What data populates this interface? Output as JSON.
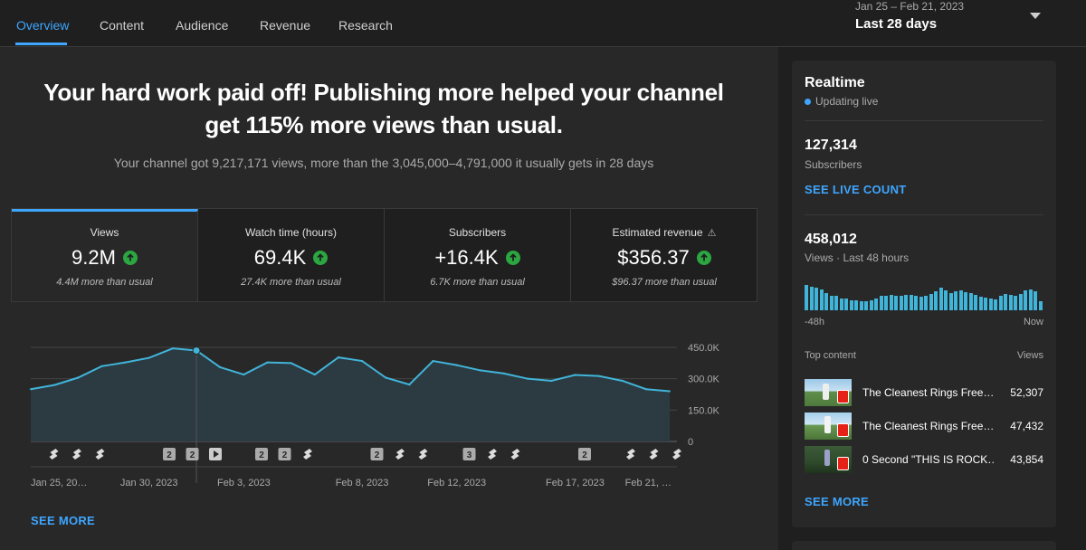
{
  "tabs": [
    {
      "label": "Overview",
      "active": true
    },
    {
      "label": "Content",
      "active": false
    },
    {
      "label": "Audience",
      "active": false
    },
    {
      "label": "Revenue",
      "active": false
    },
    {
      "label": "Research",
      "active": false
    }
  ],
  "date_range": {
    "range": "Jan 25 – Feb 21, 2023",
    "period": "Last 28 days"
  },
  "headline": {
    "line1": "Your hard work paid off! Publishing more helped your channel",
    "line2": "get 115% more views than usual.",
    "sub": "Your channel got 9,217,171 views, more than the 3,045,000–4,791,000 it usually gets in 28 days"
  },
  "metrics": [
    {
      "label": "Views",
      "value": "9.2M",
      "note": "4.4M more than usual",
      "trend": "up"
    },
    {
      "label": "Watch time (hours)",
      "value": "69.4K",
      "note": "27.4K more than usual",
      "trend": "up"
    },
    {
      "label": "Subscribers",
      "value": "+16.4K",
      "note": "6.7K more than usual",
      "trend": "up"
    },
    {
      "label": "Estimated revenue",
      "value": "$356.37",
      "note": "$96.37 more than usual",
      "trend": "up",
      "warning_icon": "warning-triangle-icon"
    }
  ],
  "chart_data": {
    "type": "area",
    "x": [
      "Jan 25",
      "Jan 26",
      "Jan 27",
      "Jan 28",
      "Jan 29",
      "Jan 30",
      "Jan 31",
      "Feb 1",
      "Feb 2",
      "Feb 3",
      "Feb 4",
      "Feb 5",
      "Feb 6",
      "Feb 7",
      "Feb 8",
      "Feb 9",
      "Feb 10",
      "Feb 11",
      "Feb 12",
      "Feb 13",
      "Feb 14",
      "Feb 15",
      "Feb 16",
      "Feb 17",
      "Feb 18",
      "Feb 19",
      "Feb 20",
      "Feb 21"
    ],
    "values": [
      250000,
      270000,
      305000,
      360000,
      378000,
      400000,
      445000,
      435000,
      355000,
      320000,
      378000,
      375000,
      320000,
      402000,
      385000,
      305000,
      272000,
      385000,
      365000,
      340000,
      325000,
      300000,
      290000,
      318000,
      313000,
      290000,
      250000,
      240000
    ],
    "ylim": [
      0,
      450000
    ],
    "yticks": [
      "450.0K",
      "300.0K",
      "150.0K",
      "0"
    ],
    "xtick_labels": [
      "Jan 25, 20…",
      "Jan 30, 2023",
      "Feb 3, 2023",
      "Feb 8, 2023",
      "Feb 12, 2023",
      "Feb 17, 2023",
      "Feb 21, …"
    ],
    "highlight_index": 7,
    "grid": true,
    "color": "#41b4d9",
    "upload_markers": [
      {
        "index": 1,
        "kind": "short"
      },
      {
        "index": 2,
        "kind": "short"
      },
      {
        "index": 3,
        "kind": "short"
      },
      {
        "index": 6,
        "kind": "count",
        "label": "2"
      },
      {
        "index": 7,
        "kind": "count",
        "label": "2"
      },
      {
        "index": 8,
        "kind": "play"
      },
      {
        "index": 10,
        "kind": "count",
        "label": "2"
      },
      {
        "index": 11,
        "kind": "count",
        "label": "2"
      },
      {
        "index": 12,
        "kind": "short"
      },
      {
        "index": 15,
        "kind": "count",
        "label": "2"
      },
      {
        "index": 16,
        "kind": "short"
      },
      {
        "index": 17,
        "kind": "short"
      },
      {
        "index": 19,
        "kind": "count",
        "label": "3"
      },
      {
        "index": 20,
        "kind": "short"
      },
      {
        "index": 21,
        "kind": "short"
      },
      {
        "index": 24,
        "kind": "count",
        "label": "2"
      },
      {
        "index": 26,
        "kind": "short"
      },
      {
        "index": 27,
        "kind": "short"
      },
      {
        "index": 28,
        "kind": "short"
      }
    ]
  },
  "main_see_more": "SEE MORE",
  "realtime": {
    "title": "Realtime",
    "status": "Updating live",
    "subscribers": "127,314",
    "subscribers_label": "Subscribers",
    "live_count_link": "SEE LIVE COUNT",
    "views": "458,012",
    "views_label": "Views · Last 48 hours",
    "axis_start": "-48h",
    "axis_end": "Now",
    "hourly_views": [
      0.95,
      0.88,
      0.82,
      0.78,
      0.62,
      0.55,
      0.52,
      0.45,
      0.42,
      0.38,
      0.36,
      0.35,
      0.34,
      0.38,
      0.42,
      0.52,
      0.55,
      0.56,
      0.55,
      0.54,
      0.56,
      0.58,
      0.55,
      0.5,
      0.52,
      0.6,
      0.7,
      0.82,
      0.75,
      0.65,
      0.7,
      0.72,
      0.68,
      0.62,
      0.58,
      0.5,
      0.46,
      0.42,
      0.4,
      0.55,
      0.6,
      0.58,
      0.55,
      0.6,
      0.72,
      0.78,
      0.7,
      0.35
    ],
    "top_content_label": "Top content",
    "views_col_label": "Views",
    "top_content": [
      {
        "title": "The Cleanest Rings Free…",
        "views": "52,307"
      },
      {
        "title": "The Cleanest Rings Free…",
        "views": "47,432"
      },
      {
        "title": "0 Second \"THIS IS ROCK…",
        "views": "43,854"
      }
    ],
    "see_more": "SEE MORE"
  }
}
